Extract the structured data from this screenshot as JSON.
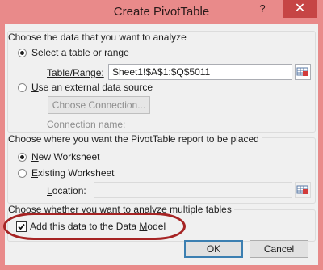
{
  "window": {
    "title": "Create PivotTable",
    "help_label": "?",
    "close_label": "✕"
  },
  "section1": {
    "heading": "Choose the data that you want to analyze",
    "option_table_label": "Select a table or range",
    "table_range_label": "Table/Range:",
    "table_range_value": "Sheet1!$A$1:$Q$5011",
    "option_external_label": "Use an external data source",
    "choose_connection_label": "Choose Connection...",
    "connection_name_label": "Connection name:"
  },
  "section2": {
    "heading": "Choose where you want the PivotTable report to be placed",
    "new_worksheet_label": "New Worksheet",
    "existing_worksheet_label": "Existing Worksheet",
    "location_label": "Location:",
    "location_value": ""
  },
  "section3": {
    "heading": "Choose whether you want to analyze multiple tables",
    "data_model_label": "Add this data to the Data Model",
    "data_model_checked": true
  },
  "buttons": {
    "ok_label": "OK",
    "cancel_label": "Cancel"
  },
  "colors": {
    "frame": "#e98a8a",
    "highlight": "#a62424",
    "close": "#c64545"
  },
  "icons": [
    "help-icon",
    "close-icon",
    "range-selector-icon",
    "checkmark-icon"
  ]
}
